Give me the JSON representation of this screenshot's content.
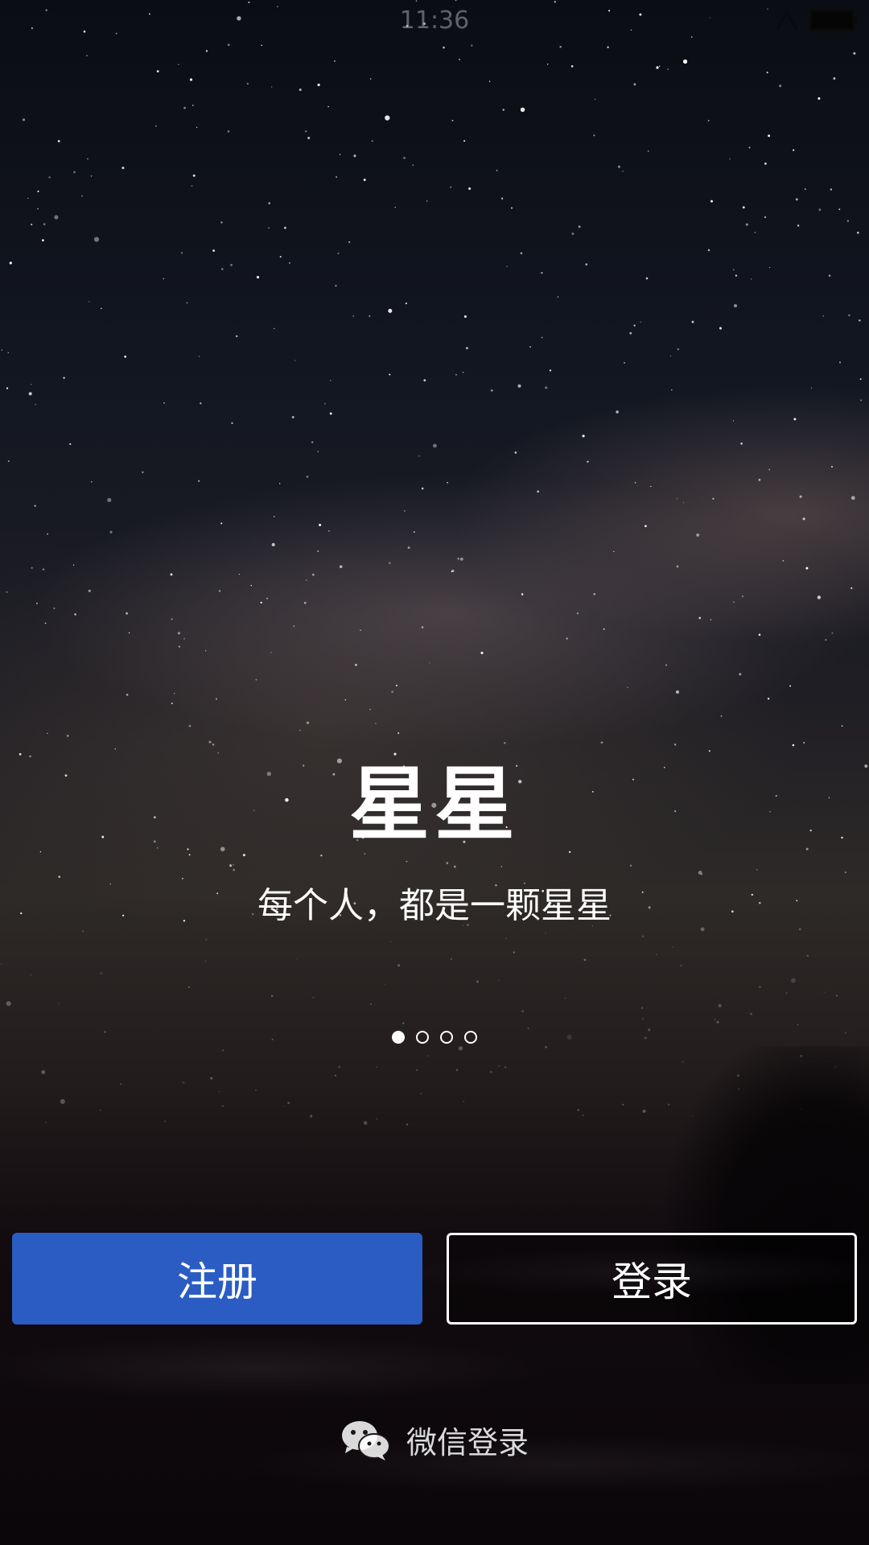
{
  "status_bar": {
    "time": "11:36"
  },
  "hero": {
    "title": "星星",
    "slogan": "每个人，都是一颗星星"
  },
  "pager": {
    "total": 4,
    "active_index": 0
  },
  "actions": {
    "register_label": "注册",
    "login_label": "登录",
    "register_color": "#2a5cc4"
  },
  "wechat": {
    "label": "微信登录",
    "icon": "wechat-icon"
  }
}
